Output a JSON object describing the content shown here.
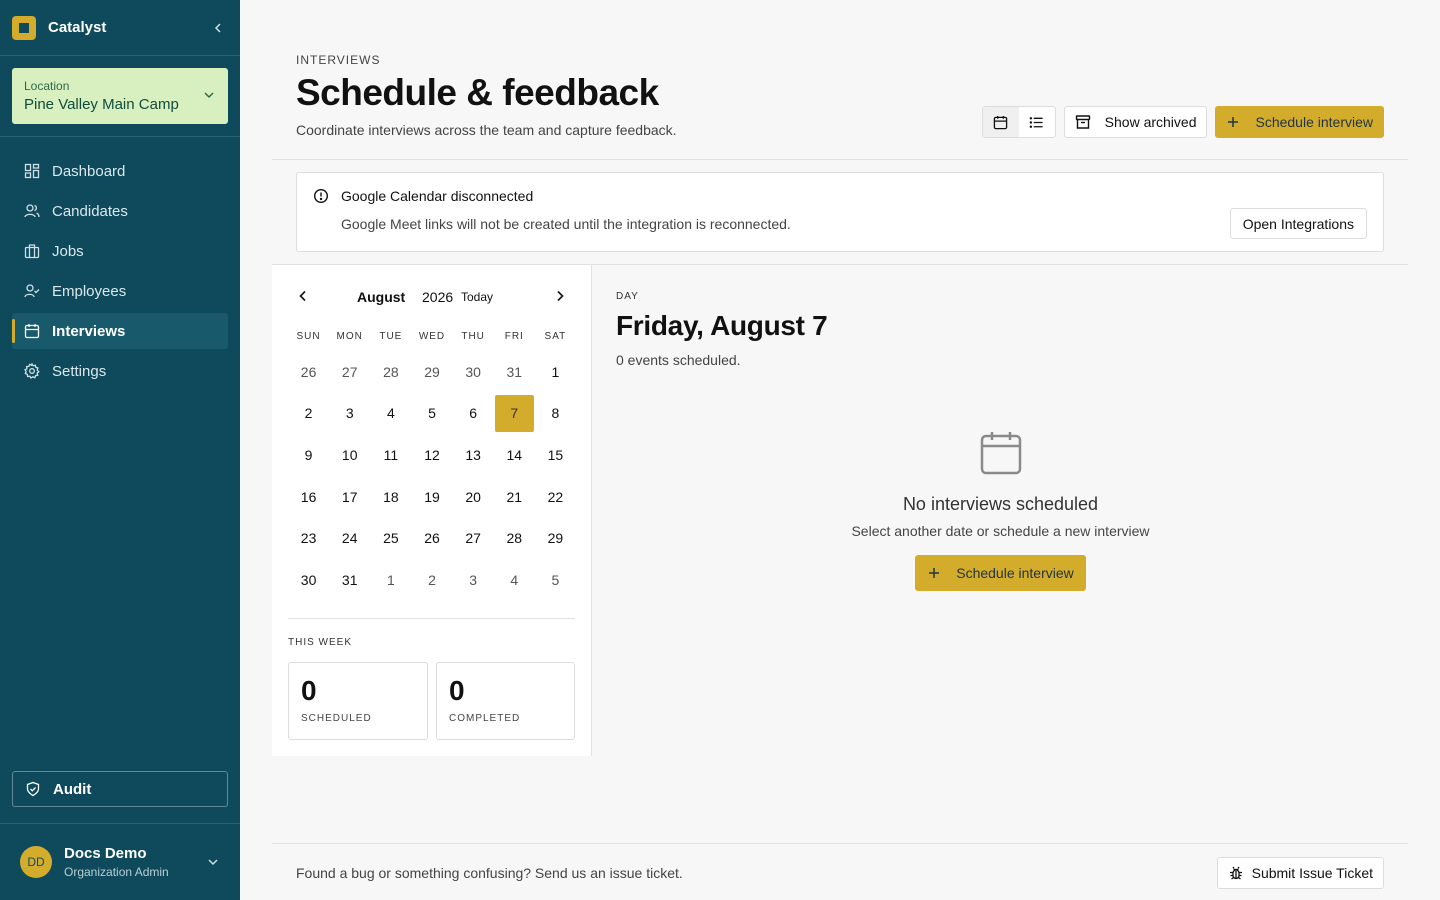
{
  "brand": {
    "name": "Catalyst"
  },
  "location": {
    "label": "Location",
    "value": "Pine Valley Main Camp"
  },
  "nav": [
    {
      "label": "Dashboard",
      "icon": "dashboard-icon"
    },
    {
      "label": "Candidates",
      "icon": "users-icon"
    },
    {
      "label": "Jobs",
      "icon": "briefcase-icon"
    },
    {
      "label": "Employees",
      "icon": "user-check-icon"
    },
    {
      "label": "Interviews",
      "icon": "calendar-icon",
      "active": true
    },
    {
      "label": "Settings",
      "icon": "gear-icon"
    }
  ],
  "audit": {
    "label": "Audit"
  },
  "user": {
    "initials": "DD",
    "name": "Docs Demo",
    "role": "Organization Admin"
  },
  "header": {
    "eyebrow": "INTERVIEWS",
    "title": "Schedule & feedback",
    "subtitle": "Coordinate interviews across the team and capture feedback.",
    "show_archived": "Show archived",
    "schedule": "Schedule interview"
  },
  "alert": {
    "title": "Google Calendar disconnected",
    "body": "Google Meet links will not be created until the integration is reconnected.",
    "button": "Open Integrations"
  },
  "calendar": {
    "month": "August",
    "year": "2026",
    "today": "Today",
    "dow": [
      "SUN",
      "MON",
      "TUE",
      "WED",
      "THU",
      "FRI",
      "SAT"
    ],
    "weeks": [
      [
        {
          "d": "26",
          "m": true
        },
        {
          "d": "27",
          "m": true
        },
        {
          "d": "28",
          "m": true
        },
        {
          "d": "29",
          "m": true
        },
        {
          "d": "30",
          "m": true
        },
        {
          "d": "31",
          "m": true
        },
        {
          "d": "1"
        }
      ],
      [
        {
          "d": "2"
        },
        {
          "d": "3"
        },
        {
          "d": "4"
        },
        {
          "d": "5"
        },
        {
          "d": "6"
        },
        {
          "d": "7",
          "s": true
        },
        {
          "d": "8"
        }
      ],
      [
        {
          "d": "9"
        },
        {
          "d": "10"
        },
        {
          "d": "11"
        },
        {
          "d": "12"
        },
        {
          "d": "13"
        },
        {
          "d": "14"
        },
        {
          "d": "15"
        }
      ],
      [
        {
          "d": "16"
        },
        {
          "d": "17"
        },
        {
          "d": "18"
        },
        {
          "d": "19"
        },
        {
          "d": "20"
        },
        {
          "d": "21"
        },
        {
          "d": "22"
        }
      ],
      [
        {
          "d": "23"
        },
        {
          "d": "24"
        },
        {
          "d": "25"
        },
        {
          "d": "26"
        },
        {
          "d": "27"
        },
        {
          "d": "28"
        },
        {
          "d": "29"
        }
      ],
      [
        {
          "d": "30"
        },
        {
          "d": "31"
        },
        {
          "d": "1",
          "m": true
        },
        {
          "d": "2",
          "m": true
        },
        {
          "d": "3",
          "m": true
        },
        {
          "d": "4",
          "m": true
        },
        {
          "d": "5",
          "m": true
        }
      ]
    ]
  },
  "week_stats": {
    "label": "THIS WEEK",
    "scheduled": {
      "value": "0",
      "label": "SCHEDULED"
    },
    "completed": {
      "value": "0",
      "label": "COMPLETED"
    }
  },
  "day": {
    "eyebrow": "DAY",
    "title": "Friday, August 7",
    "count": "0 events scheduled.",
    "empty_title": "No interviews scheduled",
    "empty_sub": "Select another date or schedule a new interview",
    "empty_button": "Schedule interview"
  },
  "footer": {
    "text": "Found a bug or something confusing? Send us an issue ticket.",
    "button": "Submit Issue Ticket"
  },
  "colors": {
    "sidebar": "#0e4a5c",
    "accent": "#d4ac2c",
    "location_bg": "#d8efbf"
  }
}
